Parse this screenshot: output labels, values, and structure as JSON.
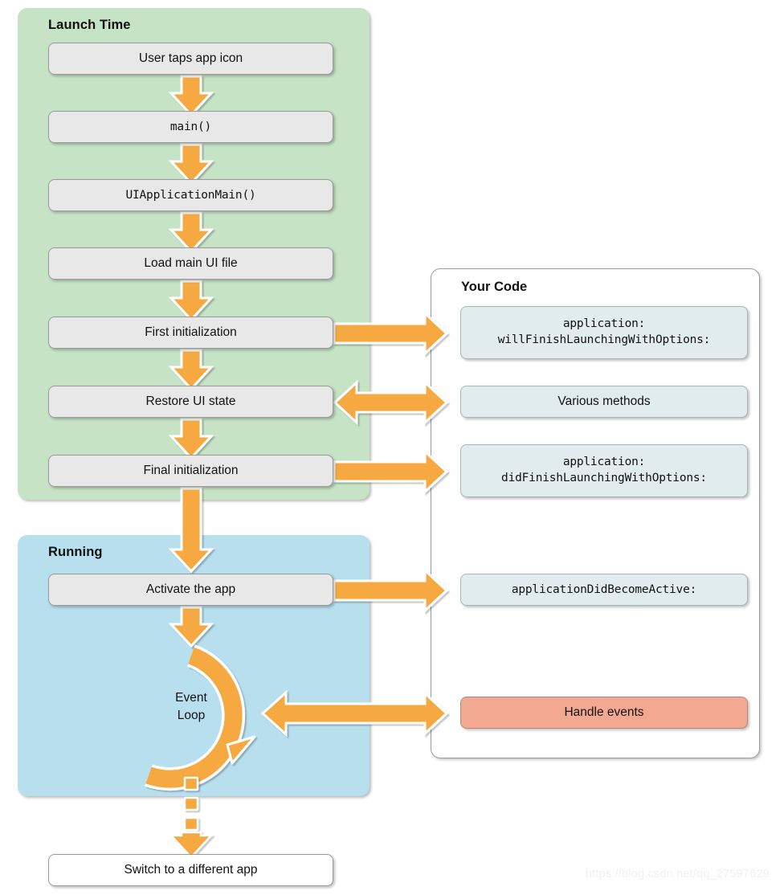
{
  "diagram": {
    "watermark": "https://blog.csdn.net/qq_27597629",
    "colors": {
      "launch_panel": "#c6e3c6",
      "running_panel": "#b8dfee",
      "arrow": "#f5a941",
      "step_box": "#e8e8e8",
      "code_box": "#e0ecee",
      "events_box": "#f2a891"
    }
  },
  "launch": {
    "title": "Launch Time",
    "steps": [
      {
        "label": "User taps app icon",
        "mono": false
      },
      {
        "label": "main()",
        "mono": true
      },
      {
        "label": "UIApplicationMain()",
        "mono": true
      },
      {
        "label": "Load main UI file",
        "mono": false
      },
      {
        "label": "First initialization",
        "mono": false
      },
      {
        "label": "Restore UI state",
        "mono": false
      },
      {
        "label": "Final initialization",
        "mono": false
      }
    ]
  },
  "running": {
    "title": "Running",
    "steps": [
      {
        "label": "Activate the app",
        "mono": false
      }
    ],
    "event_loop": {
      "label": "Event\nLoop"
    }
  },
  "exit": {
    "label": "Switch to a different app"
  },
  "your_code": {
    "title": "Your Code",
    "items": [
      {
        "label": "application:\nwillFinishLaunchingWithOptions:",
        "mono": true,
        "kind": "code",
        "lines": 2
      },
      {
        "label": "Various methods",
        "mono": false,
        "kind": "code",
        "lines": 1
      },
      {
        "label": "application:\ndidFinishLaunchingWithOptions:",
        "mono": true,
        "kind": "code",
        "lines": 2
      },
      {
        "label": "applicationDidBecomeActive:",
        "mono": true,
        "kind": "code",
        "lines": 1
      },
      {
        "label": "Handle events",
        "mono": false,
        "kind": "events",
        "lines": 1
      }
    ]
  }
}
